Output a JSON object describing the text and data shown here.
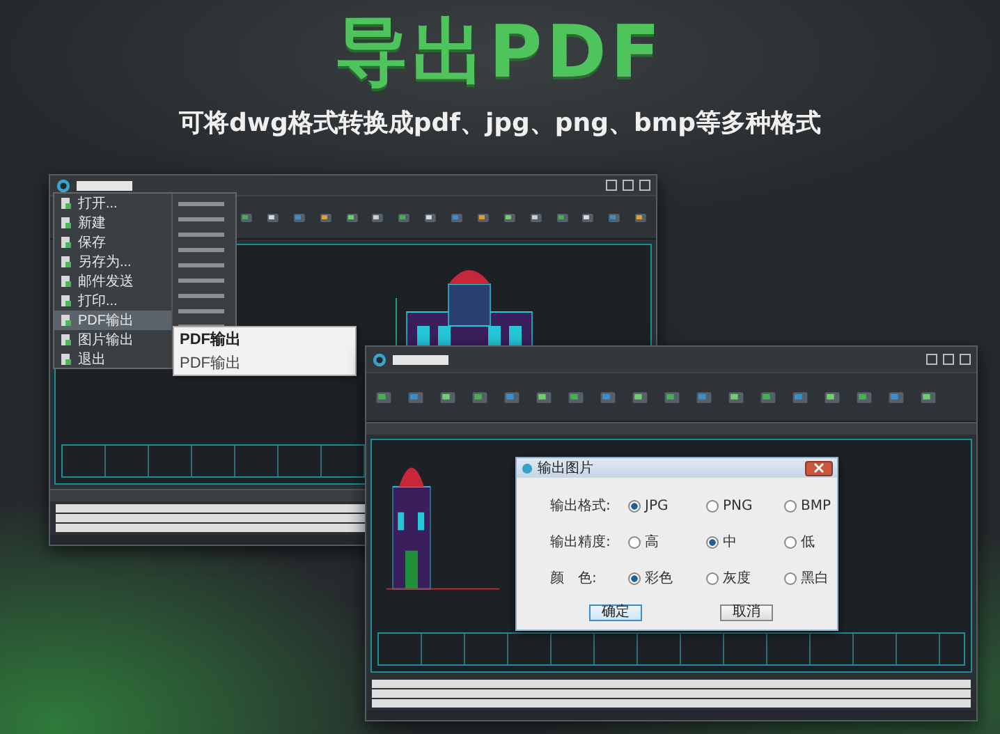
{
  "hero": {
    "title": "导出PDF",
    "subtitle": "可将dwg格式转换成pdf、jpg、png、bmp等多种格式"
  },
  "back_window": {
    "file_menu": [
      {
        "label": "打开...",
        "selected": false
      },
      {
        "label": "新建",
        "selected": false
      },
      {
        "label": "保存",
        "selected": false
      },
      {
        "label": "另存为...",
        "selected": false
      },
      {
        "label": "邮件发送",
        "selected": false
      },
      {
        "label": "打印...",
        "selected": false
      },
      {
        "label": "PDF输出",
        "selected": true
      },
      {
        "label": "图片输出",
        "selected": false
      },
      {
        "label": "退出",
        "selected": false
      }
    ],
    "submenu": [
      {
        "label": "PDF输出",
        "selected": true
      },
      {
        "label": "PDF输出",
        "selected": false
      }
    ]
  },
  "front_window": {
    "dialog": {
      "title": "输出图片",
      "rows": [
        {
          "label": "输出格式:",
          "options": [
            {
              "label": "JPG",
              "selected": true
            },
            {
              "label": "PNG",
              "selected": false
            },
            {
              "label": "BMP",
              "selected": false
            }
          ]
        },
        {
          "label": "输出精度:",
          "options": [
            {
              "label": "高",
              "selected": false
            },
            {
              "label": "中",
              "selected": true
            },
            {
              "label": "低",
              "selected": false
            }
          ]
        },
        {
          "label": "颜　色:",
          "options": [
            {
              "label": "彩色",
              "selected": true
            },
            {
              "label": "灰度",
              "selected": false
            },
            {
              "label": "黑白",
              "selected": false
            }
          ]
        }
      ],
      "buttons": [
        {
          "label": "确定",
          "kind": "primary"
        },
        {
          "label": "取消",
          "kind": "secondary"
        }
      ]
    }
  }
}
